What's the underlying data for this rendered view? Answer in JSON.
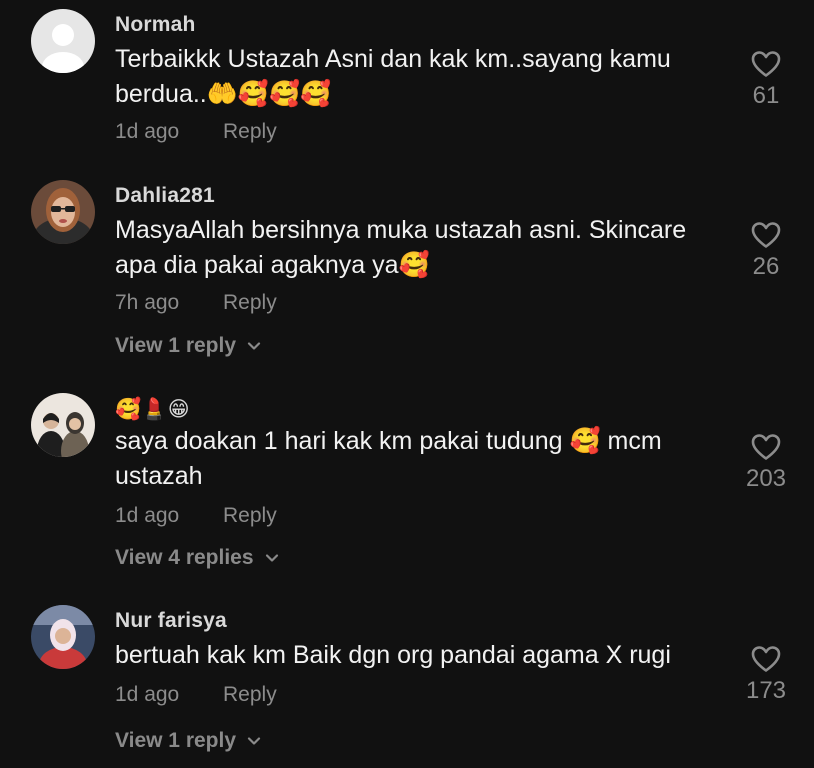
{
  "comments": [
    {
      "username": "Normah",
      "text": "Terbaikkk Ustazah Asni dan kak km..sayang kamu berdua..🤲🥰🥰🥰",
      "time": "1d ago",
      "reply_label": "Reply",
      "likes": "61",
      "view_replies": ""
    },
    {
      "username": "Dahlia281",
      "text": "MasyaAllah bersihnya muka ustazah asni. Skincare apa dia pakai agaknya ya🥰",
      "time": "7h ago",
      "reply_label": "Reply",
      "likes": "26",
      "view_replies": "View 1 reply"
    },
    {
      "username": "🥰💄😁",
      "text": "saya doakan 1 hari kak km pakai tudung 🥰 mcm ustazah",
      "time": "1d ago",
      "reply_label": "Reply",
      "likes": "203",
      "view_replies": "View 4 replies"
    },
    {
      "username": "Nur farisya",
      "text": "bertuah kak km Baik dgn org pandai agama X rugi",
      "time": "1d ago",
      "reply_label": "Reply",
      "likes": "173",
      "view_replies": "View 1 reply"
    }
  ],
  "colors": {
    "background": "#111111",
    "text": "#f2f2f2",
    "secondary": "#8c8c8c"
  },
  "icons": [
    "heart-outline-icon",
    "chevron-down-icon",
    "default-avatar-icon"
  ]
}
